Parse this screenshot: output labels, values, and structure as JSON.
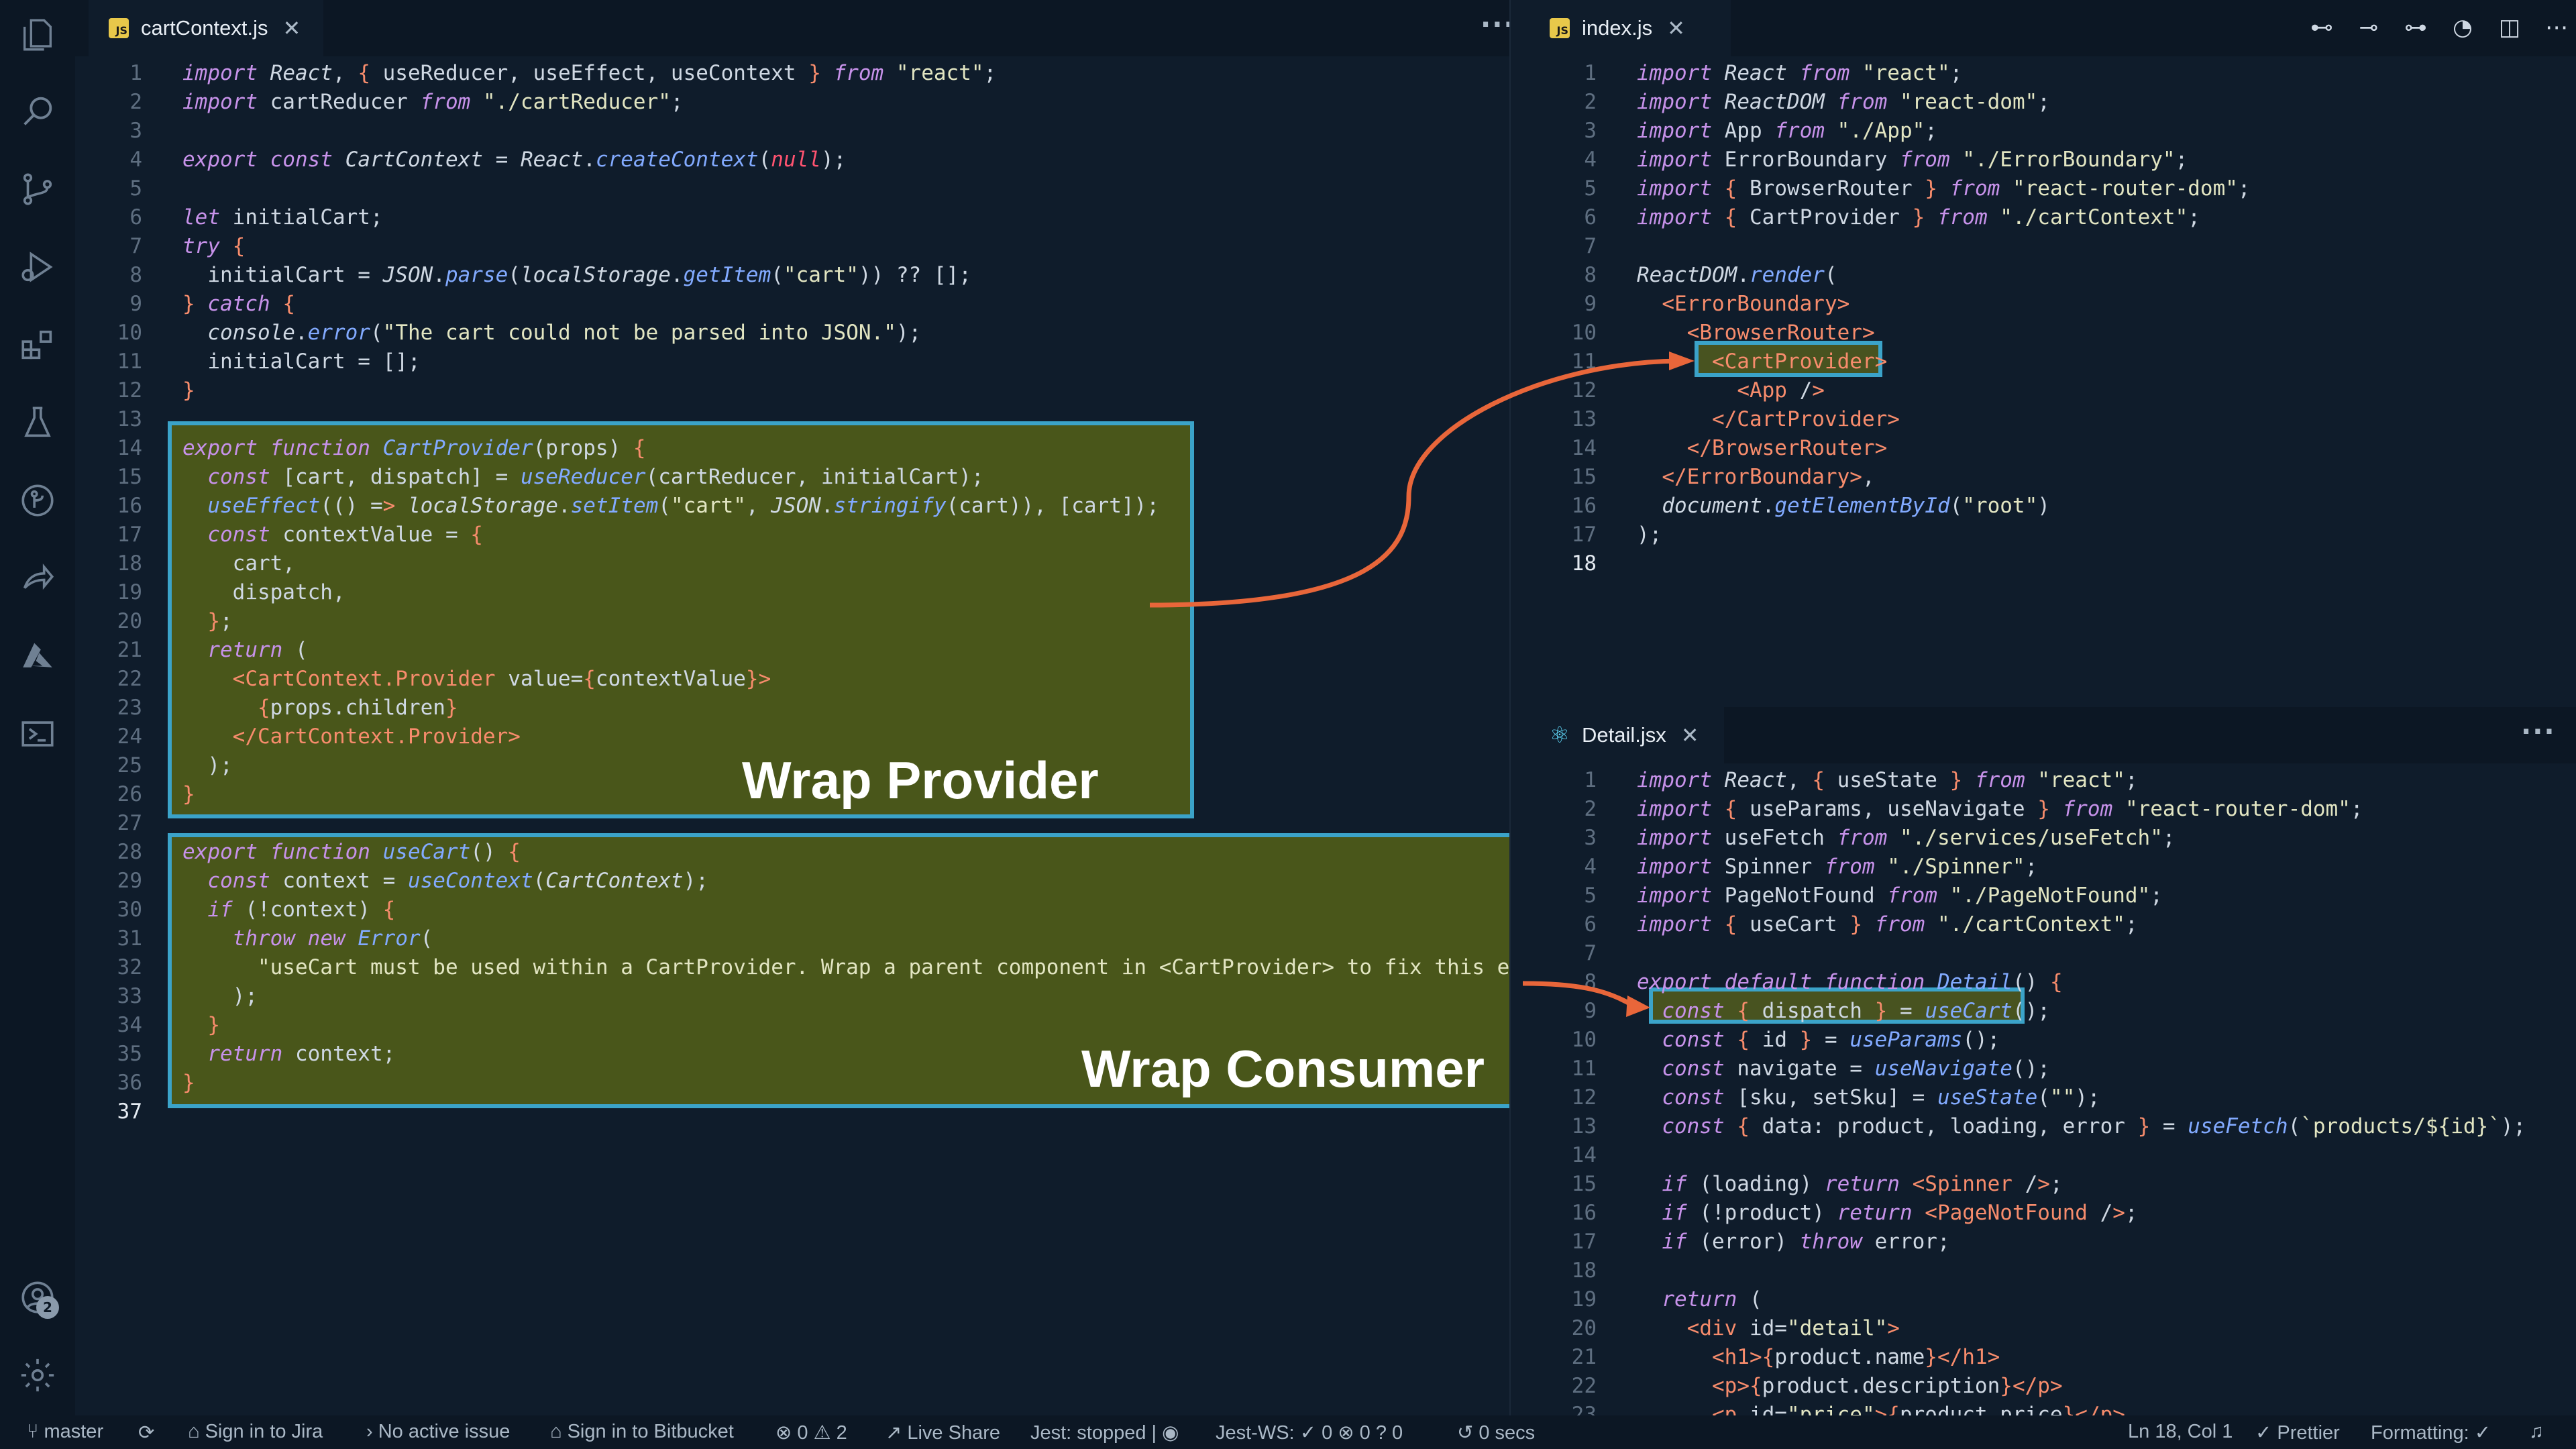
{
  "left_editor": {
    "tab": {
      "label": "cartContext.js",
      "icon": "js-file-icon",
      "close": "✕"
    },
    "more_label": "···",
    "current_line": 37,
    "lines": [
      "import React, { useReducer, useEffect, useContext } from \"react\";",
      "import cartReducer from \"./cartReducer\";",
      "",
      "export const CartContext = React.createContext(null);",
      "",
      "let initialCart;",
      "try {",
      "  initialCart = JSON.parse(localStorage.getItem(\"cart\")) ?? [];",
      "} catch {",
      "  console.error(\"The cart could not be parsed into JSON.\");",
      "  initialCart = [];",
      "}",
      "",
      "export function CartProvider(props) {",
      "  const [cart, dispatch] = useReducer(cartReducer, initialCart);",
      "  useEffect(() => localStorage.setItem(\"cart\", JSON.stringify(cart)), [cart]);",
      "  const contextValue = {",
      "    cart,",
      "    dispatch,",
      "  };",
      "  return (",
      "    <CartContext.Provider value={contextValue}>",
      "      {props.children}",
      "    </CartContext.Provider>",
      "  );",
      "}",
      "",
      "export function useCart() {",
      "  const context = useContext(CartContext);",
      "  if (!context) {",
      "    throw new Error(",
      "      \"useCart must be used within a CartProvider. Wrap a parent component in <CartProvider> to fix this error.\"",
      "    );",
      "  }",
      "  return context;",
      "}",
      ""
    ],
    "annotations": {
      "provider_label": "Wrap Provider",
      "consumer_label": "Wrap Consumer"
    }
  },
  "top_right_editor": {
    "tab": {
      "label": "index.js",
      "icon": "js-file-icon",
      "close": "✕"
    },
    "current_line": 18,
    "toolbar_icons": [
      "git-compare-icon",
      "git-commit-icon",
      "git-forward-icon",
      "timeline-icon",
      "split-editor-icon",
      "more-icon"
    ],
    "lines": [
      "import React from \"react\";",
      "import ReactDOM from \"react-dom\";",
      "import App from \"./App\";",
      "import ErrorBoundary from \"./ErrorBoundary\";",
      "import { BrowserRouter } from \"react-router-dom\";",
      "import { CartProvider } from \"./cartContext\";",
      "",
      "ReactDOM.render(",
      "  <ErrorBoundary>",
      "    <BrowserRouter>",
      "      <CartProvider>",
      "        <App />",
      "      </CartProvider>",
      "    </BrowserRouter>",
      "  </ErrorBoundary>,",
      "  document.getElementById(\"root\")",
      ");",
      ""
    ]
  },
  "bottom_right_editor": {
    "tab": {
      "label": "Detail.jsx",
      "icon": "react-icon",
      "close": "✕"
    },
    "more_label": "···",
    "lines": [
      "import React, { useState } from \"react\";",
      "import { useParams, useNavigate } from \"react-router-dom\";",
      "import useFetch from \"./services/useFetch\";",
      "import Spinner from \"./Spinner\";",
      "import PageNotFound from \"./PageNotFound\";",
      "import { useCart } from \"./cartContext\";",
      "",
      "export default function Detail() {",
      "  const { dispatch } = useCart();",
      "  const { id } = useParams();",
      "  const navigate = useNavigate();",
      "  const [sku, setSku] = useState(\"\");",
      "  const { data: product, loading, error } = useFetch(`products/${id}`);",
      "",
      "  if (loading) return <Spinner />;",
      "  if (!product) return <PageNotFound />;",
      "  if (error) throw error;",
      "",
      "  return (",
      "    <div id=\"detail\">",
      "      <h1>{product.name}</h1>",
      "      <p>{product.description}</p>",
      "      <p id=\"price\">${product.price}</p>"
    ]
  },
  "activity_bar": {
    "icons": [
      "files-icon",
      "search-icon",
      "source-control-icon",
      "run-debug-icon",
      "extensions-icon",
      "testing-icon",
      "gitlens-icon",
      "live-share-icon",
      "azure-icon",
      "terminal-icon"
    ],
    "accounts_badge": "2"
  },
  "status_bar": {
    "branch": "master",
    "jira": "Sign in to Jira",
    "issue": "No active issue",
    "bitbucket": "Sign in to Bitbucket",
    "errors": "0",
    "warnings": "2",
    "live_share": "Live Share",
    "jest": "Jest: stopped |",
    "jest_ws": "Jest-WS:",
    "jest_ws_pass": "0",
    "jest_ws_fail": "0",
    "jest_ws_unknown": "0",
    "timer": "0 secs",
    "position": "Ln 18, Col 1",
    "prettier": "Prettier",
    "formatting": "Formatting: ✓"
  },
  "colors": {
    "editor_bg": "#0f1c2b",
    "highlight_border": "#3ba3c9",
    "highlight_fill": "#606e14",
    "arrow": "#e8663a"
  }
}
